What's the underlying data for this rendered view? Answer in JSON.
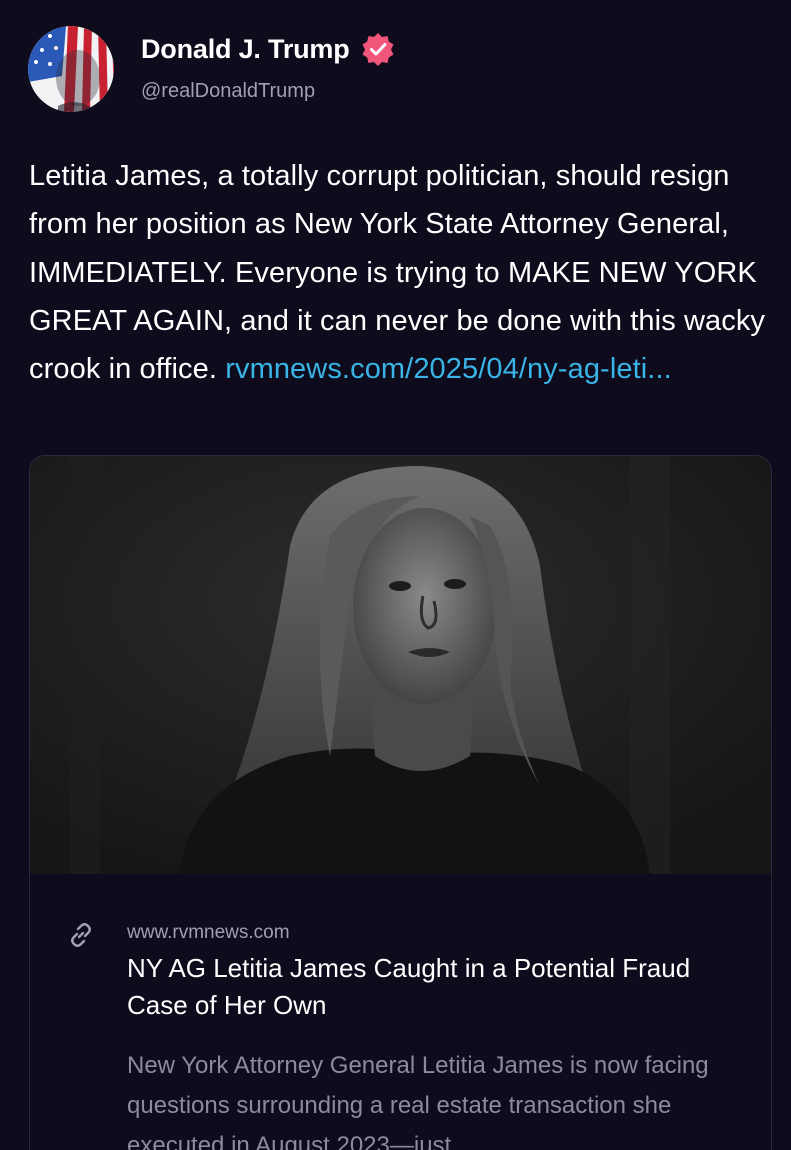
{
  "author": {
    "display_name": "Donald J. Trump",
    "handle": "@realDonaldTrump",
    "verified": true
  },
  "post": {
    "text": "Letitia James, a totally corrupt politician, should resign from her position as New York State Attorney General, IMMEDIATELY. Everyone is trying to MAKE NEW YORK GREAT AGAIN, and it can never be done with this wacky crook in office. ",
    "link_text": "rvmnews.com/2025/04/ny-ag-leti..."
  },
  "link_card": {
    "domain": "www.rvmnews.com",
    "title": "NY AG Letitia James Caught in a Potential Fraud Case of Her Own",
    "description": "New York Attorney General Letitia James is now facing questions surrounding a real estate transaction she executed in August 2023—just",
    "icon": "link-icon"
  },
  "colors": {
    "background": "#0e0b1c",
    "link": "#3ab4e6",
    "verified_badge": "#f0567a",
    "secondary_text": "#a29fb0"
  }
}
